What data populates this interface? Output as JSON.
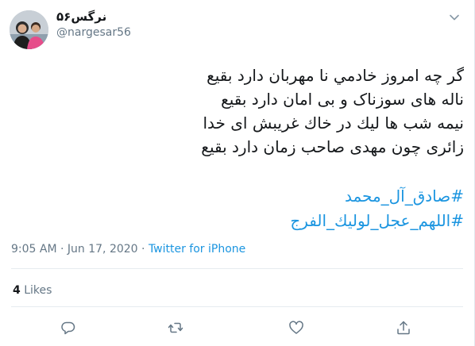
{
  "tweet": {
    "display_name": "نرگس۵۶",
    "handle": "@nargesar56",
    "lines": [
      "گر چه امروز خادمي نا مهربان دارد بقيع",
      "ناله های سوزناک و بی امان دارد بقيع",
      "نیمه شب ها لیك در خاك غريبش ای خدا",
      "زائری چون مهدی صاحب زمان دارد بقيع"
    ],
    "hashtags": [
      "#صادق_آل_محمد",
      "#اللهم_عجل_لوليك_الفرج"
    ],
    "time": "9:05 AM",
    "separator": "·",
    "date": "Jun 17, 2020",
    "source": "Twitter for iPhone",
    "likes_count": "4",
    "likes_label": "Likes"
  },
  "icons": {
    "menu": "chevron-down-icon",
    "reply": "reply-icon",
    "retweet": "retweet-icon",
    "like": "heart-icon",
    "share": "share-icon"
  },
  "colors": {
    "link": "#1b95e0",
    "secondary_text": "#657786",
    "primary_text": "#14171a"
  }
}
